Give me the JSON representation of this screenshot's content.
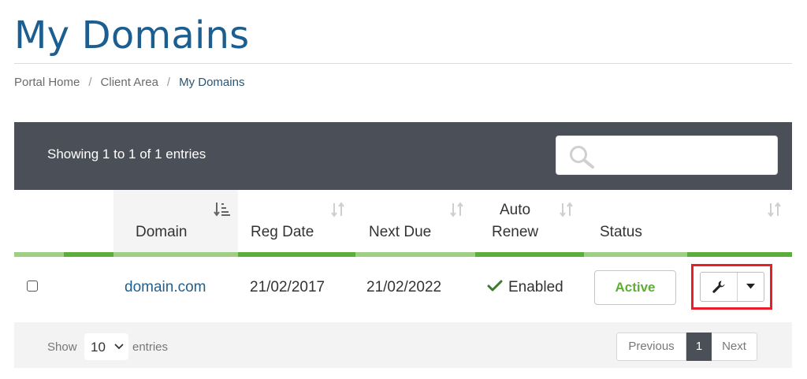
{
  "page": {
    "title": "My Domains"
  },
  "breadcrumb": [
    {
      "label": "Portal Home"
    },
    {
      "label": "Client Area"
    },
    {
      "label": "My Domains"
    }
  ],
  "breadcrumb_separator": "/",
  "table": {
    "info": "Showing 1 to 1 of 1 entries",
    "search": {
      "placeholder": "",
      "icon": "search-icon"
    },
    "columns": {
      "domain": "Domain",
      "reg_date": "Reg Date",
      "next_due": "Next Due",
      "auto_renew_1": "Auto",
      "auto_renew_2": "Renew",
      "status": "Status"
    },
    "rows": [
      {
        "domain": "domain.com",
        "reg_date": "21/02/2017",
        "next_due": "21/02/2022",
        "auto_renew": "Enabled",
        "status": "Active"
      }
    ],
    "length_label_before": "Show",
    "length_value": "10",
    "length_label_after": "entries",
    "pagination": {
      "previous": "Previous",
      "current": "1",
      "next": "Next"
    }
  },
  "colors": {
    "title": "#1b5e8f",
    "header_bg": "#4b4f58",
    "accent_green": "#5dad3d",
    "status_active": "#5cb031",
    "highlight": "#e5202a"
  }
}
